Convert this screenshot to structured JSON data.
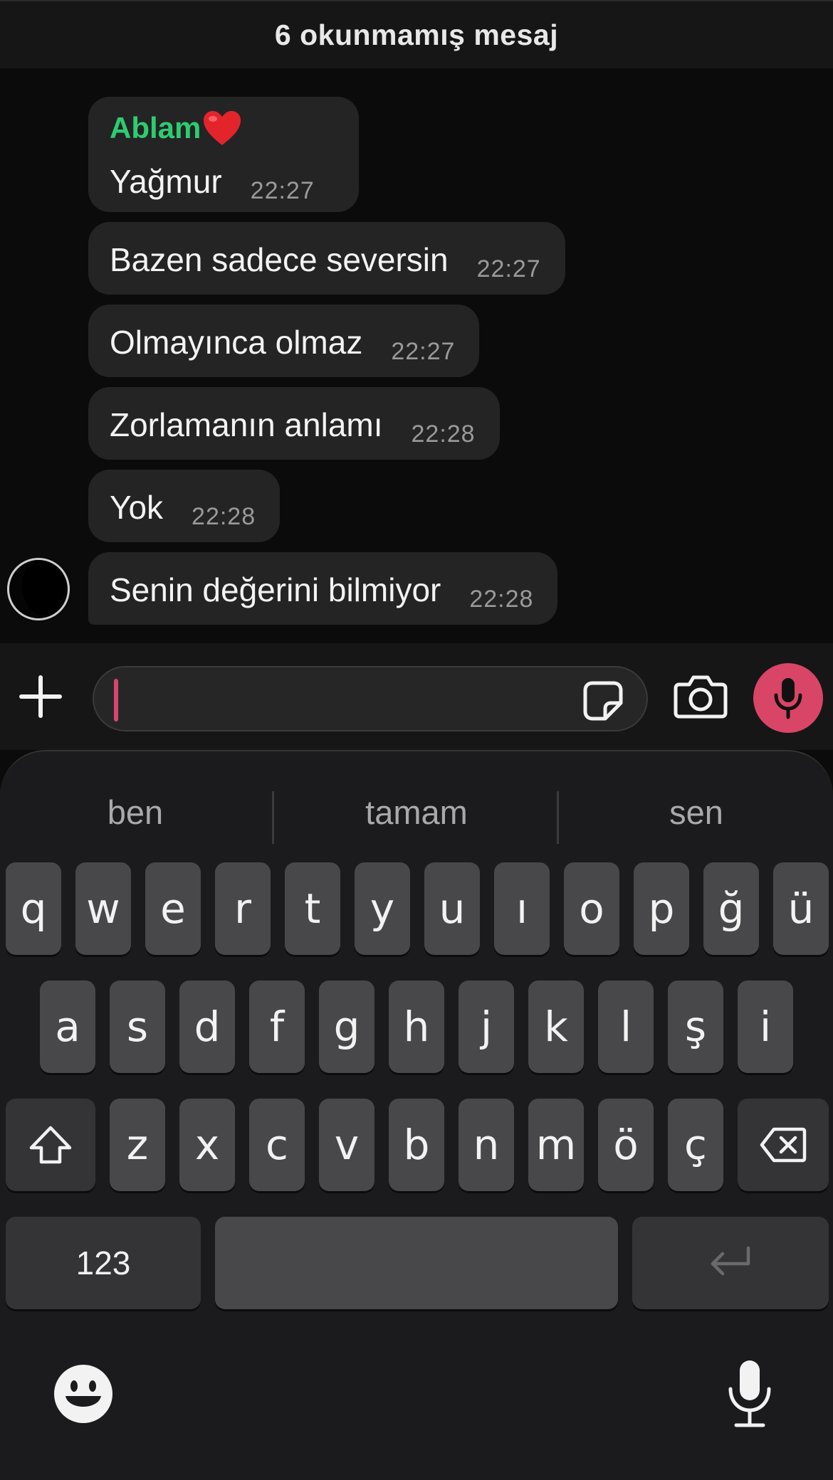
{
  "banner": {
    "unread_label": "6 okunmamış mesaj"
  },
  "messages": [
    {
      "sender": "Ablam",
      "text": "Yağmur",
      "time": "22:27"
    },
    {
      "text": "Bazen sadece seversin",
      "time": "22:27"
    },
    {
      "text": "Olmayınca olmaz",
      "time": "22:27"
    },
    {
      "text": "Zorlamanın anlamı",
      "time": "22:28"
    },
    {
      "text": "Yok",
      "time": "22:28"
    },
    {
      "text": "Senin değerini bilmiyor",
      "time": "22:28"
    }
  ],
  "composer": {
    "value": "",
    "icons": [
      "plus-icon",
      "sticker-icon",
      "camera-icon",
      "microphone-icon"
    ],
    "accent": "#d94566"
  },
  "keyboard": {
    "suggestions": [
      "ben",
      "tamam",
      "sen"
    ],
    "row1": [
      "q",
      "w",
      "e",
      "r",
      "t",
      "y",
      "u",
      "ı",
      "o",
      "p",
      "ğ",
      "ü"
    ],
    "row2": [
      "a",
      "s",
      "d",
      "f",
      "g",
      "h",
      "j",
      "k",
      "l",
      "ş",
      "i"
    ],
    "row3": [
      "z",
      "x",
      "c",
      "v",
      "b",
      "n",
      "m",
      "ö",
      "ç"
    ],
    "numbers_label": "123",
    "icons": [
      "shift-icon",
      "delete-icon",
      "return-icon",
      "emoji-icon",
      "dictation-icon"
    ]
  },
  "colors": {
    "sender_name": "#2ecc71",
    "bubble": "#242424",
    "key": "#48484b"
  }
}
